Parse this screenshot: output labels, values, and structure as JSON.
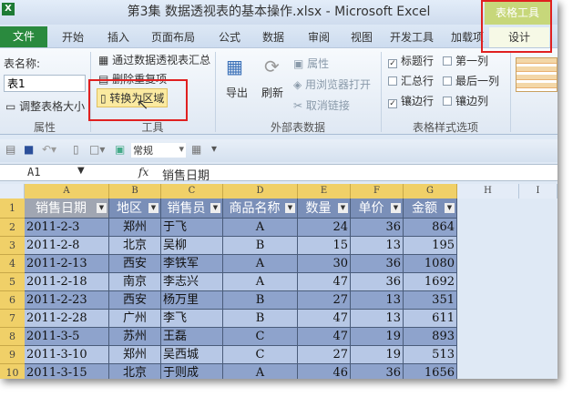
{
  "window": {
    "title": "第3集 数据透视表的基本操作.xlsx  -  Microsoft Excel",
    "app_icon": "excel-icon"
  },
  "contextual_tab": "表格工具",
  "tabs": [
    "文件",
    "开始",
    "插入",
    "页面布局",
    "公式",
    "数据",
    "审阅",
    "视图",
    "开发工具",
    "加载项",
    "设计"
  ],
  "ribbon": {
    "properties": {
      "name_label": "表名称:",
      "name_value": "表1",
      "resize": "调整表格大小",
      "group": "属性"
    },
    "tools": {
      "pivot": "通过数据透视表汇总",
      "remove_dup": "删除重复项",
      "convert": "转换为区域",
      "group": "工具"
    },
    "external": {
      "export": "导出",
      "refresh": "刷新",
      "props": "属性",
      "open_browser": "用浏览器打开",
      "unlink": "取消链接",
      "group": "外部表数据"
    },
    "style_options": {
      "header_row": "标题行",
      "total_row": "汇总行",
      "banded_rows": "镶边行",
      "first_col": "第一列",
      "last_col": "最后一列",
      "banded_cols": "镶边列",
      "checked": {
        "header_row": true,
        "total_row": false,
        "banded_rows": true,
        "first_col": false,
        "last_col": false,
        "banded_cols": false
      },
      "group": "表格样式选项"
    }
  },
  "qat": {
    "format": "常规"
  },
  "formula_bar": {
    "cell_ref": "A1",
    "fx": "fx",
    "value": "销售日期"
  },
  "columns": [
    "A",
    "B",
    "C",
    "D",
    "E",
    "F",
    "G",
    "H",
    "I"
  ],
  "headers": [
    "销售日期",
    "地区",
    "销售员",
    "商品名称",
    "数量",
    "单价",
    "金额"
  ],
  "rows": [
    [
      "2011-2-3",
      "郑州",
      "于飞",
      "A",
      "24",
      "36",
      "864"
    ],
    [
      "2011-2-8",
      "北京",
      "吴柳",
      "B",
      "15",
      "13",
      "195"
    ],
    [
      "2011-2-13",
      "西安",
      "李铁军",
      "A",
      "30",
      "36",
      "1080"
    ],
    [
      "2011-2-18",
      "南京",
      "李志兴",
      "A",
      "47",
      "36",
      "1692"
    ],
    [
      "2011-2-23",
      "西安",
      "杨万里",
      "B",
      "27",
      "13",
      "351"
    ],
    [
      "2011-2-28",
      "广州",
      "李飞",
      "B",
      "47",
      "13",
      "611"
    ],
    [
      "2011-3-5",
      "苏州",
      "王磊",
      "C",
      "47",
      "19",
      "893"
    ],
    [
      "2011-3-10",
      "郑州",
      "吴西城",
      "C",
      "27",
      "19",
      "513"
    ],
    [
      "2011-3-15",
      "北京",
      "于则成",
      "A",
      "46",
      "36",
      "1656"
    ]
  ],
  "row_numbers": [
    "1",
    "2",
    "3",
    "4",
    "5",
    "6",
    "7",
    "8",
    "9",
    "10"
  ],
  "colors": {
    "band_dark": "#8ea3cc",
    "band_light": "#b7c8e6",
    "header": "#7a8fb8",
    "highlight": "#e02020"
  }
}
